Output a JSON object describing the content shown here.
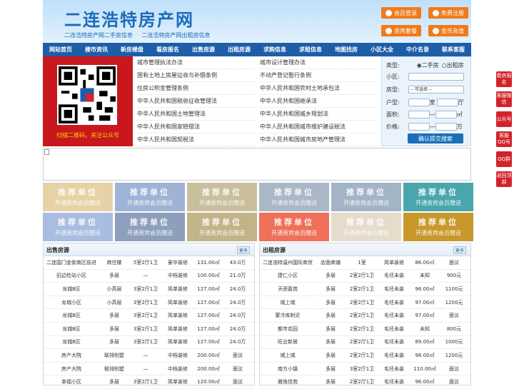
{
  "header": {
    "title": "二连浩特房产网",
    "subtitle": [
      "二连浩特房产网二手房信息",
      "二连浩特房产网出租房信息"
    ],
    "buttons": [
      "会员登录",
      "免费注册",
      "贵宾套餐",
      "金币充值"
    ]
  },
  "nav": [
    "网站首页",
    "楼市资讯",
    "新房楼盘",
    "看房报名",
    "出售房源",
    "出租房源",
    "求购信息",
    "求租信息",
    "地图找房",
    "小区大全",
    "中介名录",
    "联系客服"
  ],
  "qr": {
    "caption": "扫描二维码，关注公众号"
  },
  "links_left": [
    "城市管理执法办法",
    "国有土地上房屋征收与补偿条例",
    "住房公积金管理条例",
    "中华人民共和国税收征收管理法",
    "中华人民共和国土地管理法",
    "中华人民共和国家赔偿法",
    "中华人民共和国契税法"
  ],
  "links_right": [
    "城市设计管理办法",
    "不动产登记暂行条例",
    "中华人民共和国农村土地承包法",
    "中华人民共和国继承法",
    "中华人民共和国城乡规划法",
    "中华人民共和国城市维护建设税法",
    "中华人民共和国城市房地产管理法"
  ],
  "search": {
    "type_label": "类型:",
    "opt1": "二手房",
    "opt2": "出租房",
    "community_label": "小区:",
    "room_label": "房型:",
    "room_select": "-- 可选择 --",
    "layout_label": "户型:",
    "shi": "室",
    "ting": "厅",
    "area_label": "面积:",
    "area_unit": "㎡",
    "price_label": "价格:",
    "price_unit": "万",
    "dash": "—",
    "submit": "确认提交搜索"
  },
  "tiles": {
    "t1": "推荐单位",
    "t2": "开通贵宾会员赠送"
  },
  "tile_colors": [
    "#e6d2a6",
    "#9fb3d6",
    "#c9bf9c",
    "#a9b7c6",
    "#a2b4c6",
    "#4aa6ad",
    "#a9bde0",
    "#8e9fbd",
    "#c2b489",
    "#f0705a",
    "#e6dccc",
    "#c8982a"
  ],
  "sale": {
    "title": "出售房源",
    "more": "更多",
    "rows": [
      [
        "二连国门金街南区前进",
        "商住楼",
        "5室2厅1卫",
        "豪华装修",
        "131.00㎡",
        "43.0万"
      ],
      [
        "旧边检站小区",
        "多层",
        "—",
        "中档装修",
        "100.00㎡",
        "21.0万"
      ],
      [
        "龙城B区",
        "小高层",
        "3室2厅1卫",
        "简单装修",
        "127.00㎡",
        "24.0万"
      ],
      [
        "龙城小区",
        "小高层",
        "3室2厅1卫",
        "简单装修",
        "127.00㎡",
        "24.0万"
      ],
      [
        "龙城B区",
        "多层",
        "3室2厅1卫",
        "简单装修",
        "127.00㎡",
        "24.0万"
      ],
      [
        "龙城B区",
        "多层",
        "3室2厅1卫",
        "简单装修",
        "127.00㎡",
        "24.0万"
      ],
      [
        "龙城B区",
        "多层",
        "3室2厅1卫",
        "简单装修",
        "127.00㎡",
        "24.0万"
      ],
      [
        "房产大院",
        "联排别墅",
        "—",
        "中档装修",
        "200.00㎡",
        "面议"
      ],
      [
        "房产大院",
        "联排别墅",
        "—",
        "中档装修",
        "200.00㎡",
        "面议"
      ],
      [
        "幸福小区",
        "多层",
        "3室2厅1卫",
        "简单装修",
        "120.00㎡",
        "面议"
      ]
    ]
  },
  "rent": {
    "title": "出租房源",
    "more": "更多",
    "rows": [
      [
        "二连浩特温州国际商贸",
        "店面商铺",
        "1室",
        "简单装修",
        "86.00㎡",
        "面议"
      ],
      [
        "建仁小区",
        "多层",
        "2室2厅1卫",
        "毛坯未装",
        "未知",
        "900元"
      ],
      [
        "天骄嘉苑",
        "多层",
        "2室2厅1卫",
        "毛坯未装",
        "96.00㎡",
        "1100元"
      ],
      [
        "城上城",
        "多层",
        "2室2厅1卫",
        "毛坯未装",
        "97.00㎡",
        "1200元"
      ],
      [
        "蒙冷库附近",
        "多层",
        "2室2厅1卫",
        "毛坯未装",
        "97.00㎡",
        "面议"
      ],
      [
        "都市花园",
        "多层",
        "2室2厅1卫",
        "毛坯未装",
        "未知",
        "800元"
      ],
      [
        "旺业新居",
        "多层",
        "2室2厅1卫",
        "毛坯未装",
        "89.00㎡",
        "1000元"
      ],
      [
        "城上城",
        "多层",
        "2室2厅1卫",
        "毛坯未装",
        "98.00㎡",
        "1200元"
      ],
      [
        "南方小镇",
        "多层",
        "3室2厅1卫",
        "毛坯未装",
        "110.00㎡",
        "面议"
      ],
      [
        "雅逸佳苑",
        "多层",
        "2室2厅1卫",
        "毛坯未装",
        "96.00㎡",
        "面议"
      ]
    ]
  },
  "side": [
    "看房报名",
    "客服微信",
    "公众号",
    "客服QQ号",
    "QQ群",
    "返回顶部"
  ]
}
